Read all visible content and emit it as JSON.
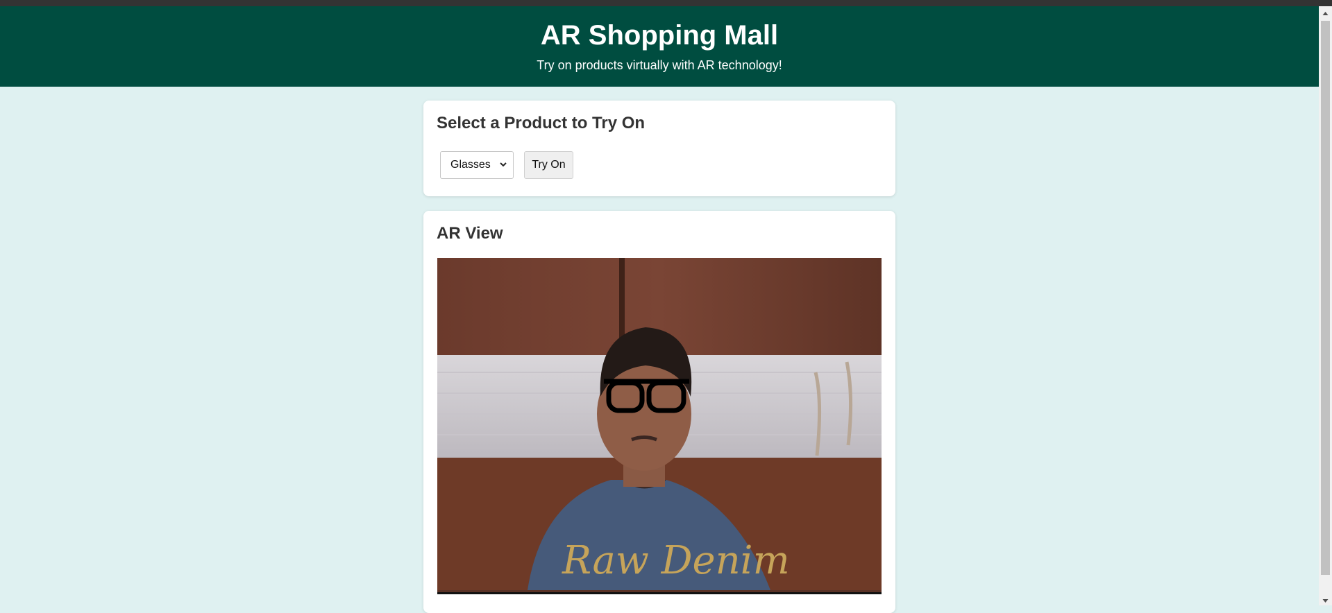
{
  "header": {
    "title": "AR Shopping Mall",
    "subtitle": "Try on products virtually with AR technology!"
  },
  "selector": {
    "heading": "Select a Product to Try On",
    "selected_product": "Glasses",
    "try_on_label": "Try On"
  },
  "ar_view": {
    "heading": "AR View",
    "overlay": "glasses",
    "camera_text": "Raw Denim"
  },
  "colors": {
    "header_bg": "#004d40",
    "page_bg": "#dff1f1",
    "card_bg": "#ffffff"
  }
}
